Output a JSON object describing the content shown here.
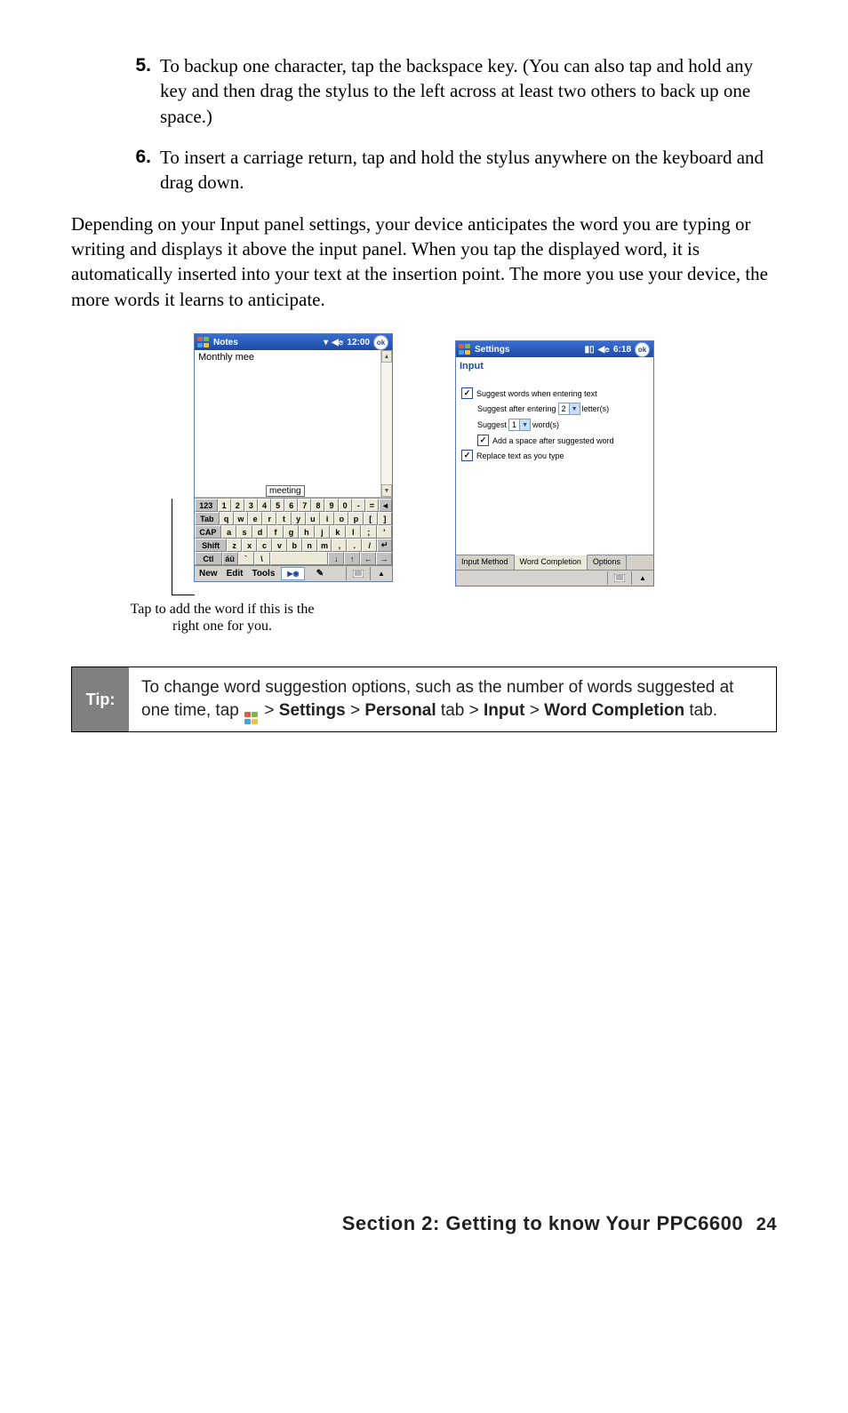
{
  "list": {
    "item5": {
      "num": "5.",
      "text": "To backup one character, tap the backspace key. (You can also tap and hold any key and then drag the stylus to the left across at least two others to back up one space.)"
    },
    "item6": {
      "num": "6.",
      "text": "To insert a carriage return, tap and hold the stylus anywhere on the keyboard and drag down."
    }
  },
  "paragraph": "Depending on your Input panel settings, your device anticipates the word you are typing or writing and displays it above the input panel. When you tap the displayed word, it is automatically inserted into your text at the insertion point. The more you use your device, the more words it learns to anticipate.",
  "notes": {
    "title": "Notes",
    "time": "12:00",
    "ok": "ok",
    "typed": "Monthly mee",
    "suggestion": "meeting",
    "keyboard": {
      "row1": [
        "123",
        "1",
        "2",
        "3",
        "4",
        "5",
        "6",
        "7",
        "8",
        "9",
        "0",
        "-",
        "=",
        "◄"
      ],
      "row2": [
        "Tab",
        "q",
        "w",
        "e",
        "r",
        "t",
        "y",
        "u",
        "i",
        "o",
        "p",
        "[",
        "]"
      ],
      "row3": [
        "CAP",
        "a",
        "s",
        "d",
        "f",
        "g",
        "h",
        "j",
        "k",
        "l",
        ";",
        "'"
      ],
      "row4": [
        "Shift",
        "z",
        "x",
        "c",
        "v",
        "b",
        "n",
        "m",
        ",",
        ".",
        "/",
        "↵"
      ],
      "row5": [
        "Ctl",
        "áü",
        "`",
        "\\",
        "",
        "",
        "↓",
        "↑",
        "←",
        "→"
      ]
    },
    "menubar": {
      "new": "New",
      "edit": "Edit",
      "tools": "Tools"
    }
  },
  "settings": {
    "title": "Settings",
    "time": "6:18",
    "ok": "ok",
    "subtitle": "Input",
    "opts": {
      "chk_suggest": "Suggest words when entering text",
      "suggest_after_a": "Suggest after entering",
      "suggest_after_val": "2",
      "suggest_after_b": "letter(s)",
      "suggest_a": "Suggest",
      "suggest_val": "1",
      "suggest_b": "word(s)",
      "chk_addspace": "Add a space after suggested word",
      "chk_replace": "Replace text as you type"
    },
    "tabs": {
      "t1": "Input Method",
      "t2": "Word Completion",
      "t3": "Options"
    }
  },
  "callout": "Tap to add the word if this is the right one for you.",
  "tip": {
    "label": "Tip:",
    "text_a": "To change word suggestion options, such as the number of  words suggested at one time, tap ",
    "gt": " > ",
    "settings": "Settings",
    "personal": "Personal",
    "tab_word": " tab > ",
    "input": "Input",
    "gt2": " > ",
    "wordcomp": "Word Completion",
    "tab_end": " tab."
  },
  "footer": {
    "section": "Section 2: Getting to know Your PPC6600",
    "page": "24"
  }
}
